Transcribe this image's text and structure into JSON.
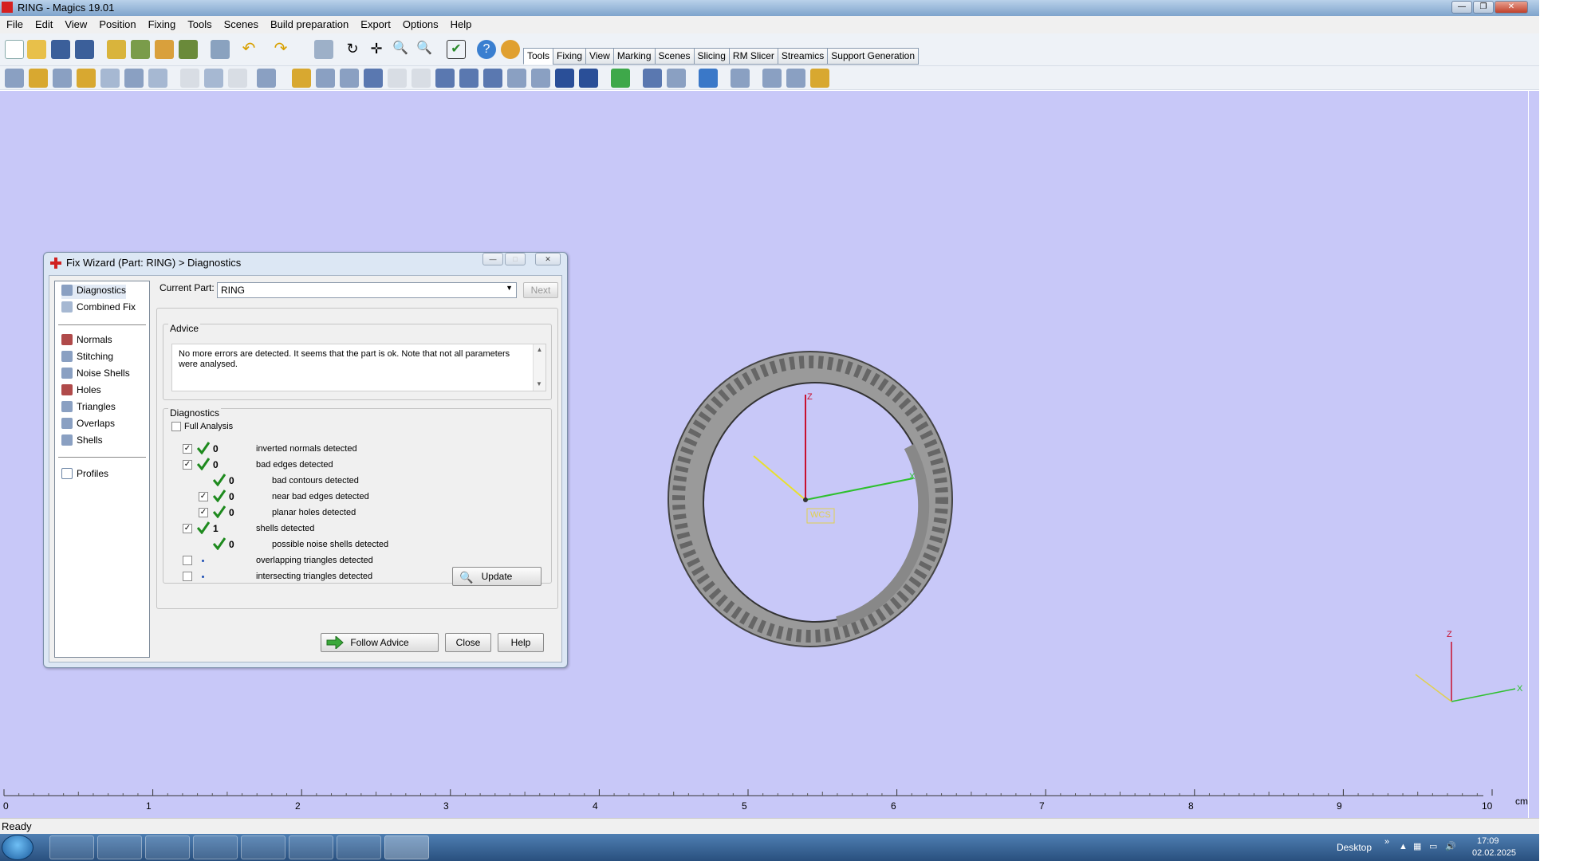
{
  "window": {
    "title": "RING - Magics 19.01"
  },
  "menu": [
    "File",
    "Edit",
    "View",
    "Position",
    "Fixing",
    "Tools",
    "Scenes",
    "Build preparation",
    "Export",
    "Options",
    "Help"
  ],
  "ribbon_tabs": [
    "Tools",
    "Fixing",
    "View",
    "Marking",
    "Scenes",
    "Slicing",
    "RM Slicer",
    "Streamics",
    "Support Generation"
  ],
  "viewport": {
    "axis_labels": {
      "z": "Z",
      "x": "X",
      "wcs": "WCS"
    },
    "ruler": {
      "ticks": [
        "0",
        "1",
        "2",
        "3",
        "4",
        "5",
        "6",
        "7",
        "8",
        "9",
        "10"
      ],
      "unit": "cm"
    }
  },
  "status": {
    "text": "Ready"
  },
  "dialog": {
    "title": "Fix Wizard (Part: RING) > Diagnostics",
    "nav": {
      "group1": [
        "Diagnostics",
        "Combined Fix"
      ],
      "group2": [
        "Normals",
        "Stitching",
        "Noise Shells",
        "Holes",
        "Triangles",
        "Overlaps",
        "Shells"
      ],
      "group3": [
        "Profiles"
      ]
    },
    "current_part_label": "Current Part:",
    "current_part_value": "RING",
    "next_label": "Next",
    "advice_title": "Advice",
    "advice_text": "No more errors are detected. It seems that the part is ok. Note that not all parameters were analysed.",
    "diagnostics_title": "Diagnostics",
    "full_analysis_label": "Full Analysis",
    "rows": [
      {
        "checked": true,
        "status": "ok",
        "count": "0",
        "label": "inverted normals detected",
        "indent": 0
      },
      {
        "checked": true,
        "status": "ok",
        "count": "0",
        "label": "bad edges detected",
        "indent": 0
      },
      {
        "checked": null,
        "status": "ok",
        "count": "0",
        "label": "bad contours detected",
        "indent": 1
      },
      {
        "checked": true,
        "status": "ok",
        "count": "0",
        "label": "near bad edges detected",
        "indent": 1
      },
      {
        "checked": true,
        "status": "ok",
        "count": "0",
        "label": "planar holes detected",
        "indent": 1
      },
      {
        "checked": true,
        "status": "ok",
        "count": "1",
        "label": "shells detected",
        "indent": 0
      },
      {
        "checked": null,
        "status": "ok",
        "count": "0",
        "label": "possible noise shells detected",
        "indent": 1
      },
      {
        "checked": false,
        "status": "dot",
        "count": "",
        "label": "overlapping triangles detected",
        "indent": 0
      },
      {
        "checked": false,
        "status": "dot",
        "count": "",
        "label": "intersecting triangles detected",
        "indent": 0
      }
    ],
    "update_label": "Update",
    "follow_advice_label": "Follow Advice",
    "close_label": "Close",
    "help_label": "Help"
  },
  "taskbar": {
    "desktop_label": "Desktop",
    "time": "17:09",
    "date": "02.02.2025"
  }
}
